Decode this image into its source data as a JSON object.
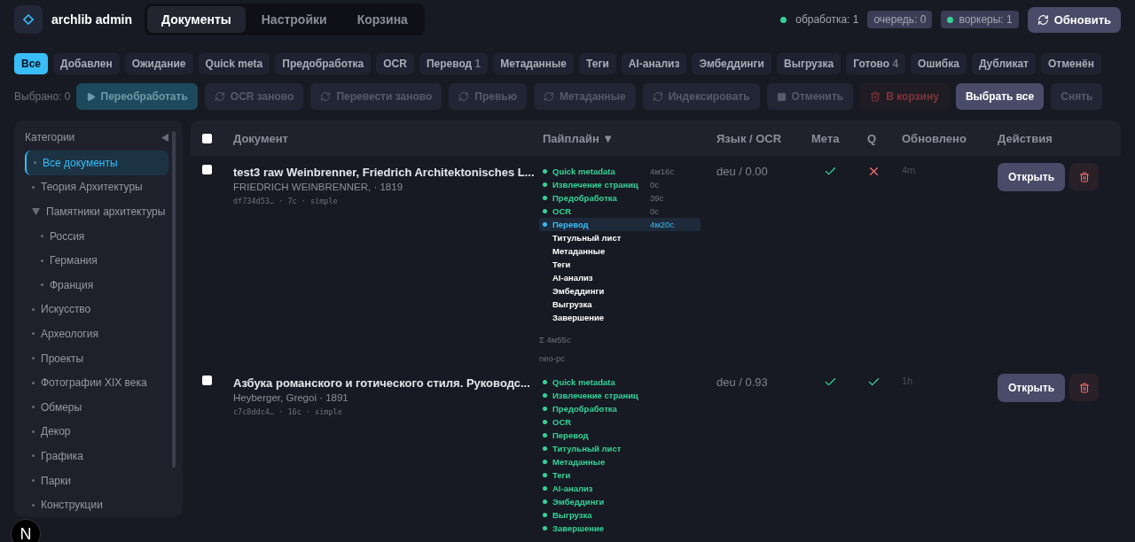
{
  "app": {
    "title": "archlib admin"
  },
  "nav_tabs": [
    {
      "label": "Документы",
      "selected": true
    },
    {
      "label": "Настройки",
      "selected": false
    },
    {
      "label": "Корзина",
      "selected": false
    }
  ],
  "status": {
    "processing": "обработка: 1",
    "queue": "очередь: 0",
    "workers": "воркеры: 1",
    "refresh_button": "Обновить"
  },
  "filters": [
    {
      "label": "Все",
      "selected": true
    },
    {
      "label": "Добавлен",
      "selected": false
    },
    {
      "label": "Ожидание",
      "selected": false
    },
    {
      "label": "Quick meta",
      "selected": false
    },
    {
      "label": "Предобработка",
      "selected": false
    },
    {
      "label": "OCR",
      "selected": false
    },
    {
      "label": "Перевод",
      "count": "1",
      "selected": false
    },
    {
      "label": "Метаданные",
      "selected": false
    },
    {
      "label": "Теги",
      "selected": false
    },
    {
      "label": "AI-анализ",
      "selected": false
    },
    {
      "label": "Эмбеддинги",
      "selected": false
    },
    {
      "label": "Выгрузка",
      "selected": false
    },
    {
      "label": "Готово",
      "count": "4",
      "selected": false
    },
    {
      "label": "Ошибка",
      "selected": false
    },
    {
      "label": "Дубликат",
      "selected": false
    },
    {
      "label": "Отменён",
      "selected": false
    }
  ],
  "selection": {
    "label": "Выбрано: 0"
  },
  "actions": [
    {
      "label": "Переобработать",
      "kind": "rerun",
      "disabled": true
    },
    {
      "label": "OCR заново",
      "kind": "redo",
      "disabled": true
    },
    {
      "label": "Перевести заново",
      "kind": "redo",
      "disabled": true
    },
    {
      "label": "Превью",
      "kind": "redo",
      "disabled": true
    },
    {
      "label": "Метаданные",
      "kind": "redo",
      "disabled": true
    },
    {
      "label": "Индексировать",
      "kind": "redo",
      "disabled": true
    },
    {
      "label": "Отменить",
      "kind": "stop",
      "disabled": true
    },
    {
      "label": "В корзину",
      "kind": "trash",
      "disabled": true
    },
    {
      "label": "Выбрать все",
      "kind": "select",
      "disabled": false
    },
    {
      "label": "Снять",
      "kind": "clear",
      "disabled": true
    }
  ],
  "sidebar": {
    "title": "Категории",
    "items": [
      {
        "label": "Все документы",
        "selected": true
      },
      {
        "label": "Теория Архитектуры",
        "selected": false
      },
      {
        "label": "Памятники архитектуры",
        "selected": false,
        "expanded": true,
        "children": [
          {
            "label": "Россия",
            "selected": false
          },
          {
            "label": "Германия",
            "selected": false
          },
          {
            "label": "Франция",
            "selected": false
          }
        ]
      },
      {
        "label": "Искусство",
        "selected": false
      },
      {
        "label": "Археология",
        "selected": false
      },
      {
        "label": "Проекты",
        "selected": false
      },
      {
        "label": "Фотографии XIX века",
        "selected": false
      },
      {
        "label": "Обмеры",
        "selected": false
      },
      {
        "label": "Декор",
        "selected": false
      },
      {
        "label": "Графика",
        "selected": false
      },
      {
        "label": "Парки",
        "selected": false
      },
      {
        "label": "Конструкции",
        "selected": false
      }
    ]
  },
  "table": {
    "select_all_checked": false,
    "columns": [
      "Документ",
      "Пайплайн ▼",
      "Язык / OCR",
      "Мета",
      "Q",
      "Обновлено",
      "Действия"
    ],
    "rows": [
      {
        "checked": false,
        "title": "test3 raw Weinbrenner, Friedrich Architektonisches L...",
        "author": "FRIEDRICH WEINBRENNER, · 1819",
        "meta": "df734d53… · 7с · simple",
        "stages": [
          {
            "name": "Quick metadata",
            "time": "4м16с",
            "kind": "done"
          },
          {
            "name": "Извлечение страниц",
            "time": "0с",
            "kind": "done"
          },
          {
            "name": "Предобработка",
            "time": "39с",
            "kind": "done"
          },
          {
            "name": "OCR",
            "time": "0с",
            "kind": "done"
          },
          {
            "name": "Перевод",
            "time": "4м20с",
            "kind": "active"
          },
          {
            "name": "Титульный лист",
            "kind": "pending"
          },
          {
            "name": "Метаданные",
            "kind": "pending"
          },
          {
            "name": "Теги",
            "kind": "pending"
          },
          {
            "name": "AI-анализ",
            "kind": "pending"
          },
          {
            "name": "Эмбеддинги",
            "kind": "pending"
          },
          {
            "name": "Выгрузка",
            "kind": "pending"
          },
          {
            "name": "Завершение",
            "kind": "pending"
          }
        ],
        "total": "Σ 4м55с",
        "host": "neo-pc",
        "lang": "deu / 0.00",
        "meta_ok": true,
        "q_ok": false,
        "updated": "4m",
        "open_button": "Открыть"
      },
      {
        "checked": false,
        "title": "Азбука романского и готического стиля. Руководс...",
        "author": "Heyberger, Gregoi · 1891",
        "meta": "c7c8ddc4… · 16с · simple",
        "stages": [
          {
            "name": "Quick metadata",
            "kind": "done"
          },
          {
            "name": "Извлечение страниц",
            "kind": "done"
          },
          {
            "name": "Предобработка",
            "kind": "done"
          },
          {
            "name": "OCR",
            "kind": "done"
          },
          {
            "name": "Перевод",
            "kind": "done"
          },
          {
            "name": "Титульный лист",
            "kind": "done"
          },
          {
            "name": "Метаданные",
            "kind": "done"
          },
          {
            "name": "Теги",
            "kind": "done"
          },
          {
            "name": "AI-анализ",
            "kind": "done"
          },
          {
            "name": "Эмбеддинги",
            "kind": "done"
          },
          {
            "name": "Выгрузка",
            "kind": "done"
          },
          {
            "name": "Завершение",
            "kind": "done"
          }
        ],
        "lang": "deu / 0.93",
        "meta_ok": true,
        "q_ok": true,
        "updated": "1h",
        "open_button": "Открыть"
      }
    ]
  },
  "dev_badge": {
    "label": "N"
  }
}
